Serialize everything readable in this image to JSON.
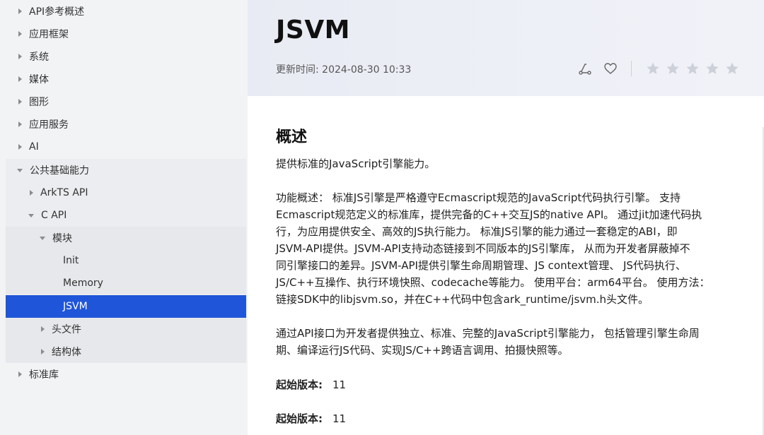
{
  "sidebar": {
    "items": [
      {
        "label": "API参考概述"
      },
      {
        "label": "应用框架"
      },
      {
        "label": "系统"
      },
      {
        "label": "媒体"
      },
      {
        "label": "图形"
      },
      {
        "label": "应用服务"
      },
      {
        "label": "AI"
      },
      {
        "label": "公共基础能力"
      },
      {
        "label": "ArkTS API"
      },
      {
        "label": "C API"
      },
      {
        "label": "模块"
      },
      {
        "label": "Init"
      },
      {
        "label": "Memory"
      },
      {
        "label": "JSVM"
      },
      {
        "label": "头文件"
      },
      {
        "label": "结构体"
      },
      {
        "label": "标准库"
      }
    ]
  },
  "header": {
    "title": "JSVM",
    "updated": "更新时间: 2024-08-30 10:33",
    "icons": [
      "share-icon",
      "heart-icon"
    ],
    "stars": 5
  },
  "content": {
    "section_title": "概述",
    "p1": "提供标准的JavaScript引擎能力。",
    "p2_lines": [
      "功能概述： 标准JS引擎是严格遵守Ecmascript规范的JavaScript代码执行引擎。 支持",
      "Ecmascript规范定义的标准库，提供完备的C++交互JS的native API。 通过jit加速代码执",
      "行，为应用提供安全、高效的JS执行能力。 标准JS引擎的能力通过一套稳定的ABI，即",
      "JSVM-API提供。JSVM-API支持动态链接到不同版本的JS引擎库， 从而为开发者屏蔽掉不",
      "同引擎接口的差异。JSVM-API提供引擎生命周期管理、JS context管理、 JS代码执行、",
      "JS/C++互操作、执行环境快照、codecache等能力。 使用平台：arm64平台。 使用方法：",
      "链接SDK中的libjsvm.so，并在C++代码中包含ark_runtime/jsvm.h头文件。"
    ],
    "p3_lines": [
      "通过API接口为开发者提供独立、标准、完整的JavaScript引擎能力， 包括管理引擎生命周",
      "期、编译运行JS代码、实现JS/C++跨语言调用、拍摄快照等。"
    ],
    "since_1": {
      "label": "起始版本:",
      "value": "11"
    },
    "since_2": {
      "label": "起始版本:",
      "value": "11"
    }
  }
}
